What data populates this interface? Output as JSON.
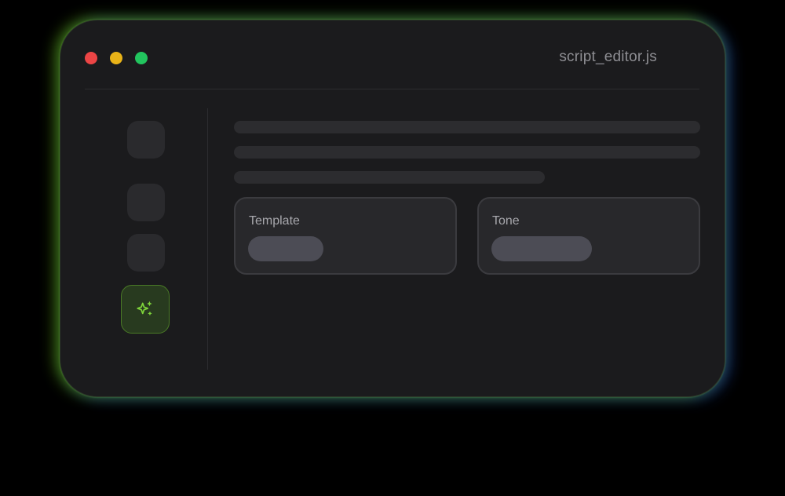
{
  "window": {
    "title": "script_editor.js",
    "traffic_lights": {
      "close_color": "#ec4545",
      "minimize_color": "#e9b318",
      "maximize_color": "#22c55e"
    }
  },
  "sidebar": {
    "items": [
      {
        "icon": "placeholder-icon"
      },
      {
        "icon": "placeholder-icon"
      },
      {
        "icon": "placeholder-icon"
      },
      {
        "icon": "sparkles-icon",
        "active": true,
        "accent": "#7ed43a"
      }
    ]
  },
  "main": {
    "cards": [
      {
        "label": "Template"
      },
      {
        "label": "Tone"
      }
    ]
  }
}
